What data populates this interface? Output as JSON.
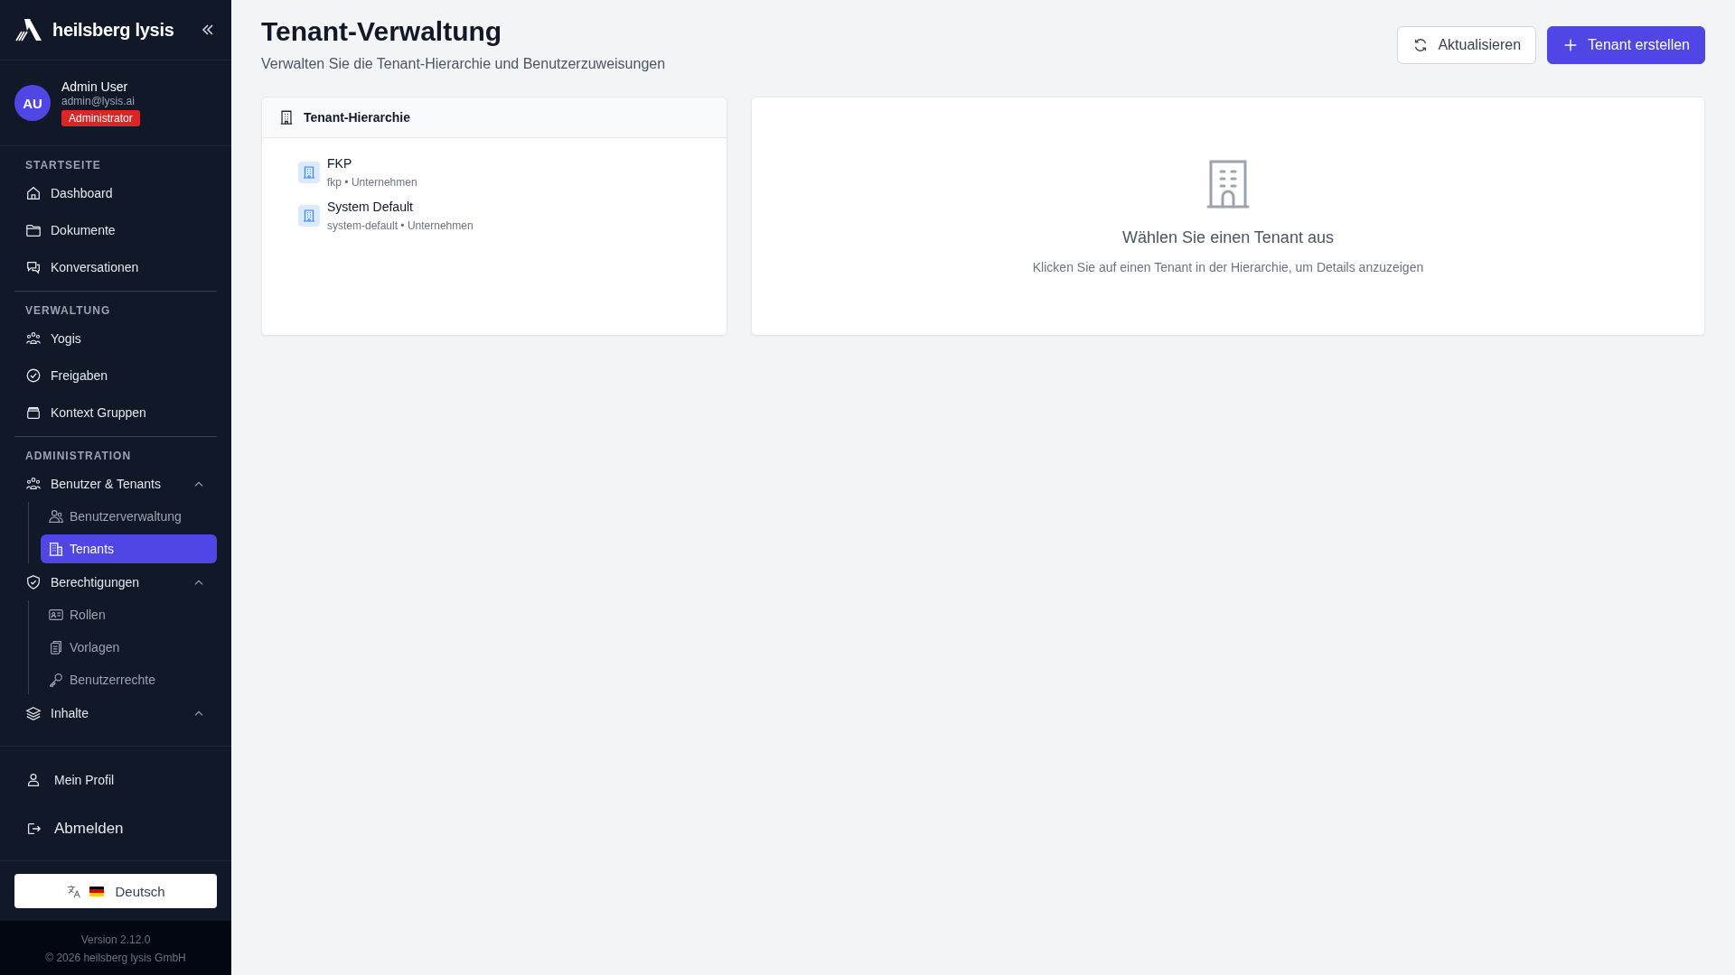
{
  "brand": {
    "name": "heilsberg lysis"
  },
  "user": {
    "initials": "AU",
    "name": "Admin User",
    "email": "admin@lysis.ai",
    "role": "Administrator"
  },
  "nav_sections": [
    {
      "title": "STARTSEITE",
      "items": [
        {
          "kind": "link",
          "label": "Dashboard",
          "selected": false
        },
        {
          "kind": "link",
          "label": "Dokumente",
          "selected": false
        },
        {
          "kind": "link",
          "label": "Konversationen",
          "selected": false
        }
      ]
    },
    {
      "title": "VERWALTUNG",
      "items": [
        {
          "kind": "link",
          "label": "Yogis",
          "selected": false
        },
        {
          "kind": "link",
          "label": "Freigaben",
          "selected": false
        },
        {
          "kind": "link",
          "label": "Kontext Gruppen",
          "selected": false
        }
      ]
    },
    {
      "title": "ADMINISTRATION",
      "items": [
        {
          "kind": "group",
          "label": "Benutzer & Tenants",
          "expanded": true,
          "children": [
            {
              "label": "Benutzerverwaltung",
              "selected": false
            },
            {
              "label": "Tenants",
              "selected": true
            }
          ]
        },
        {
          "kind": "group",
          "label": "Berechtigungen",
          "expanded": true,
          "children": [
            {
              "label": "Rollen",
              "selected": false
            },
            {
              "label": "Vorlagen",
              "selected": false
            },
            {
              "label": "Benutzerrechte",
              "selected": false
            }
          ]
        },
        {
          "kind": "group",
          "label": "Inhalte",
          "expanded": true
        }
      ]
    }
  ],
  "account_links": [
    "Mein Profil",
    "Abmelden"
  ],
  "language": {
    "label": "Deutsch"
  },
  "footer": {
    "version": "Version 2.12.0",
    "copyright": "© 2026 heilsberg lysis GmbH"
  },
  "page": {
    "title": "Tenant-Verwaltung",
    "subtitle": "Verwalten Sie die Tenant-Hierarchie und Benutzerzuweisungen"
  },
  "buttons": [
    "Aktualisieren",
    "Tenant erstellen"
  ],
  "hierarchy": {
    "title": "Tenant-Hierarchie",
    "tenants": [
      {
        "name": "FKP",
        "meta": "fkp • Unternehmen",
        "selected": false
      },
      {
        "name": "System Default",
        "meta": "system-default • Unternehmen",
        "selected": false
      }
    ]
  },
  "detail": {
    "empty_title": "Wählen Sie einen Tenant aus",
    "empty_text": "Klicken Sie auf einen Tenant in der Hierarchie, um Details anzuzeigen"
  }
}
